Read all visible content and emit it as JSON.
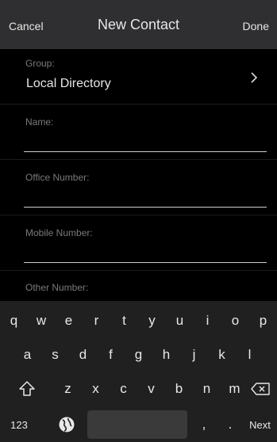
{
  "header": {
    "cancel": "Cancel",
    "title": "New Contact",
    "done": "Done"
  },
  "group": {
    "label": "Group:",
    "value": "Local Directory"
  },
  "fields": [
    {
      "label": "Name:",
      "value": ""
    },
    {
      "label": "Office Number:",
      "value": ""
    },
    {
      "label": "Mobile Number:",
      "value": ""
    },
    {
      "label": "Other Number:",
      "value": ""
    }
  ],
  "keyboard": {
    "row1": [
      "q",
      "w",
      "e",
      "r",
      "t",
      "y",
      "u",
      "i",
      "o",
      "p"
    ],
    "row2": [
      "a",
      "s",
      "d",
      "f",
      "g",
      "h",
      "j",
      "k",
      "l"
    ],
    "row3": [
      "z",
      "x",
      "c",
      "v",
      "b",
      "n",
      "m"
    ],
    "numbers_key": "123",
    "comma_key": ",",
    "period_key": ".",
    "next_key": "Next",
    "shift_icon": "shift-icon",
    "backspace_icon": "backspace-icon",
    "globe_icon": "globe-icon"
  }
}
